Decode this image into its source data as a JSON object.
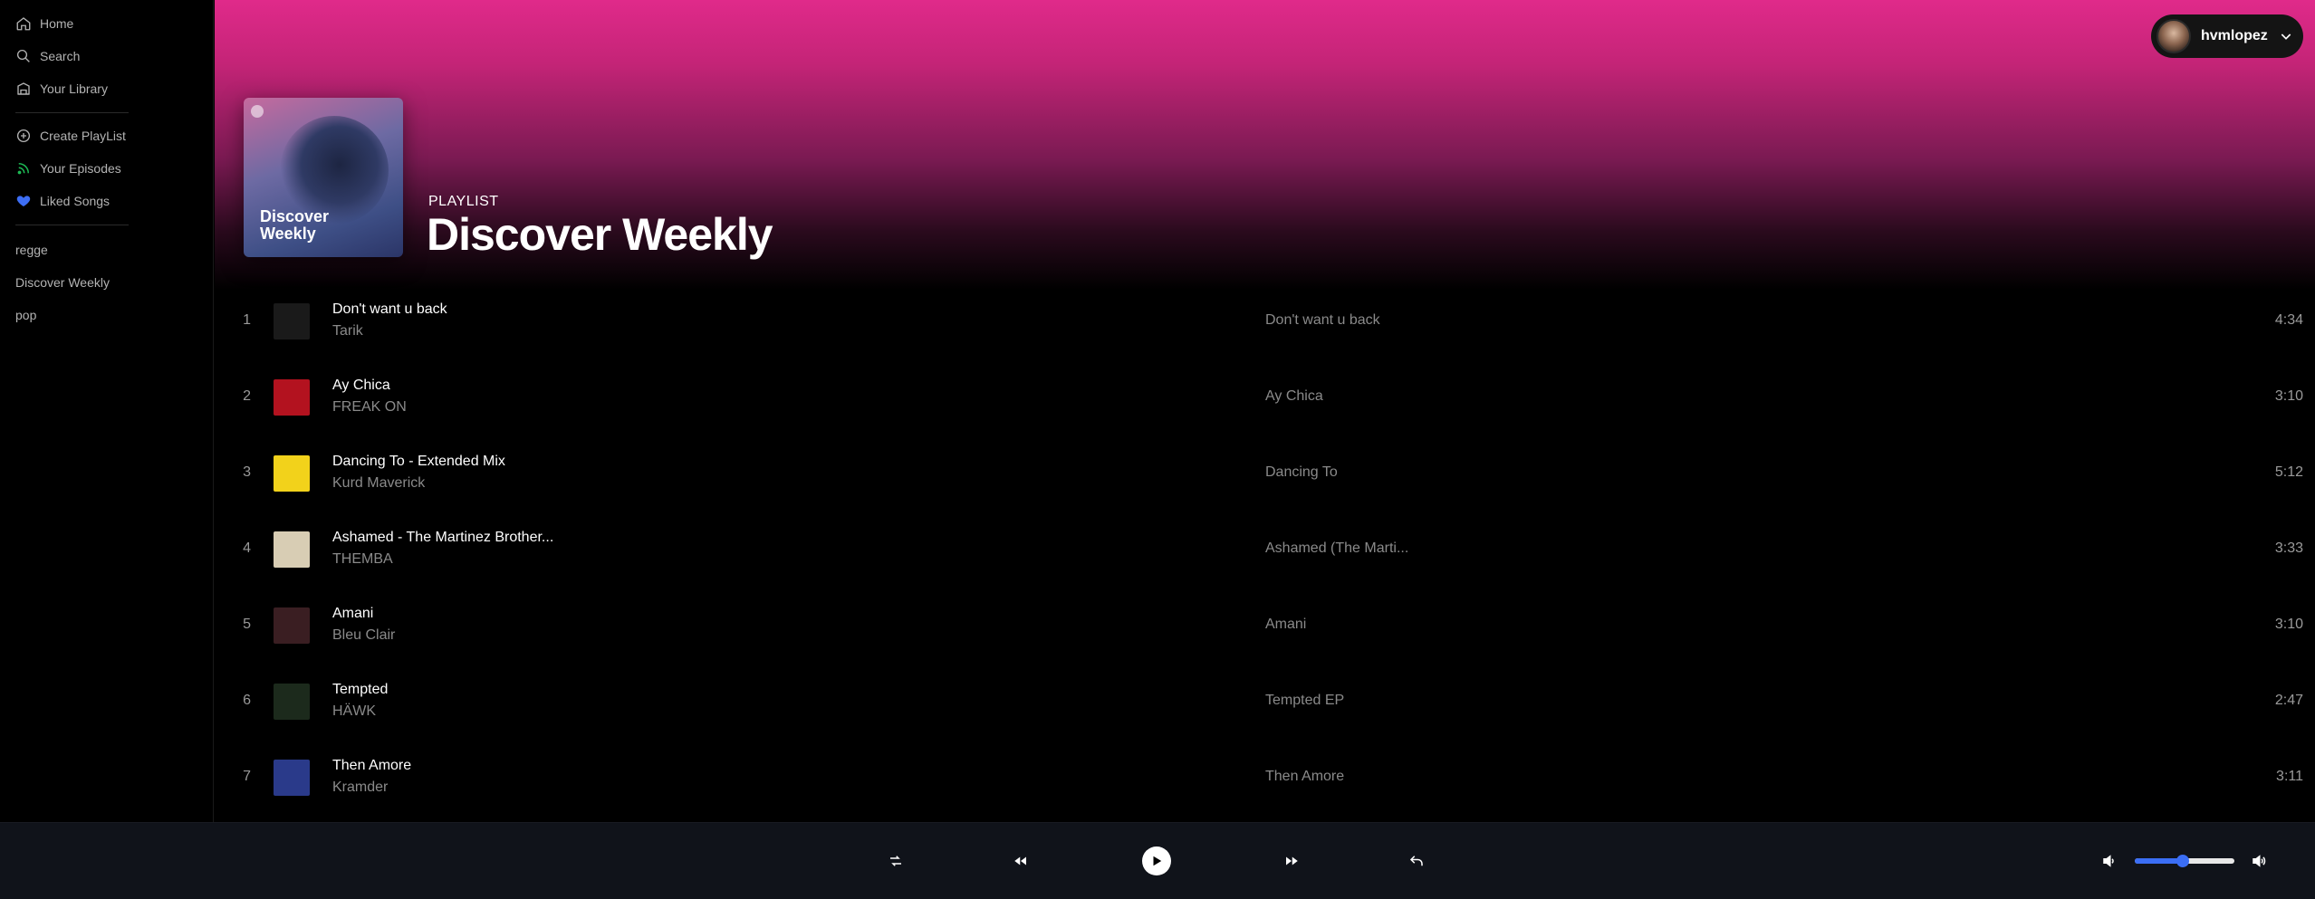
{
  "sidebar": {
    "nav": [
      {
        "label": "Home",
        "icon": "home-icon"
      },
      {
        "label": "Search",
        "icon": "search-icon"
      },
      {
        "label": "Your Library",
        "icon": "library-icon"
      }
    ],
    "actions": [
      {
        "label": "Create PlayList",
        "icon": "plus-circle-icon"
      },
      {
        "label": "Your Episodes",
        "icon": "podcast-icon",
        "color": "#1db954"
      },
      {
        "label": "Liked Songs",
        "icon": "heart-icon",
        "color": "#3d6ef5"
      }
    ],
    "playlists": [
      "regge",
      "Discover Weekly",
      "pop"
    ]
  },
  "header": {
    "type_label": "PLAYLIST",
    "title": "Discover Weekly",
    "cover_text": "Discover Weekly",
    "gradient_color": "#e02a8a",
    "user": {
      "name": "hvmlopez"
    }
  },
  "tracks": [
    {
      "num": "1",
      "title": "Don't want u back",
      "artist": "Tarik",
      "album": "Don't want u back",
      "duration": "4:34",
      "art_color": "#1a1a1a"
    },
    {
      "num": "2",
      "title": "Ay Chica",
      "artist": "FREAK ON",
      "album": "Ay Chica",
      "duration": "3:10",
      "art_color": "#b3121f"
    },
    {
      "num": "3",
      "title": "Dancing To - Extended Mix",
      "artist": "Kurd Maverick",
      "album": "Dancing To",
      "duration": "5:12",
      "art_color": "#f2d21b"
    },
    {
      "num": "4",
      "title": "Ashamed - The Martinez Brother...",
      "artist": "THEMBA",
      "album": "Ashamed (The Marti...",
      "duration": "3:33",
      "art_color": "#d8cdb4"
    },
    {
      "num": "5",
      "title": "Amani",
      "artist": "Bleu Clair",
      "album": "Amani",
      "duration": "3:10",
      "art_color": "#3a1e22"
    },
    {
      "num": "6",
      "title": "Tempted",
      "artist": "HÄWK",
      "album": "Tempted EP",
      "duration": "2:47",
      "art_color": "#1c2a1c"
    },
    {
      "num": "7",
      "title": "Then Amore",
      "artist": "Kramder",
      "album": "Then Amore",
      "duration": "3:11",
      "art_color": "#2a3a8a"
    }
  ],
  "player": {
    "controls": [
      "shuffle-icon",
      "previous-icon",
      "play-icon",
      "next-icon",
      "repeat-icon"
    ],
    "volume": 0.48,
    "accent": "#3b6ef5"
  }
}
